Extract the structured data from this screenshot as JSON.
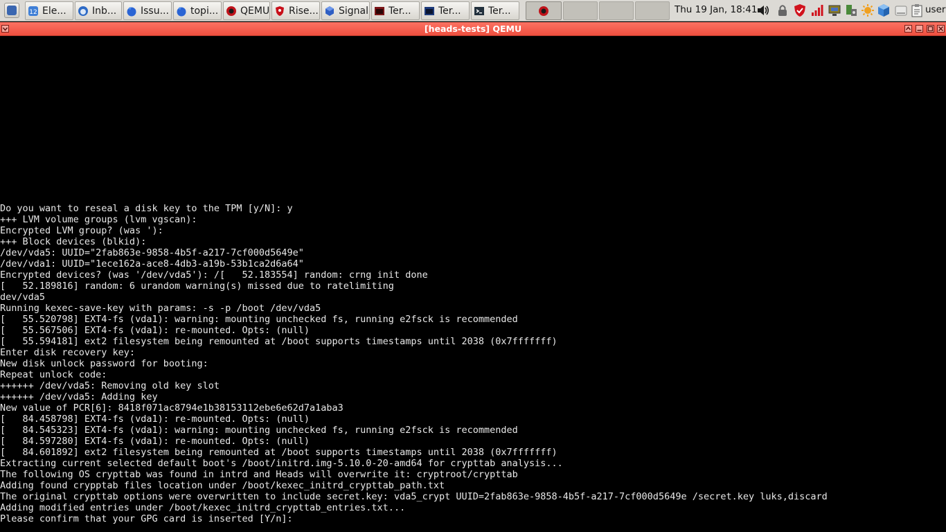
{
  "taskbar": {
    "tasks": [
      {
        "label": "Ele...",
        "icon": "element-icon"
      },
      {
        "label": "Inb...",
        "icon": "thunderbird-icon"
      },
      {
        "label": "Issu...",
        "icon": "firefox-icon"
      },
      {
        "label": "topi...",
        "icon": "firefox-icon"
      },
      {
        "label": "QEMU",
        "icon": "qemu-icon"
      },
      {
        "label": "Rise...",
        "icon": "riseup-icon"
      },
      {
        "label": "Signal",
        "icon": "signal-icon"
      },
      {
        "label": "Ter...",
        "icon": "terminal-icon"
      },
      {
        "label": "Ter...",
        "icon": "terminal-icon"
      },
      {
        "label": "Ter...",
        "icon": "terminal-icon"
      }
    ],
    "clock": "Thu 19 Jan, 18:41",
    "user": "user",
    "tray_icons": [
      "volume-icon",
      "lock-icon",
      "shield-icon",
      "signal-bars-icon",
      "monitor-icon",
      "network-icon",
      "updates-icon",
      "cube-icon",
      "disk-icon",
      "clipboard-icon"
    ]
  },
  "window": {
    "title": "[heads-tests] QEMU"
  },
  "terminal": {
    "lines": [
      "Do you want to reseal a disk key to the TPM [y/N]: y",
      "+++ LVM volume groups (lvm vgscan):",
      "Encrypted LVM group? (was '):",
      "+++ Block devices (blkid):",
      "/dev/vda5: UUID=\"2fab863e-9858-4b5f-a217-7cf000d5649e\"",
      "/dev/vda1: UUID=\"1ece162a-ace8-4db3-a19b-53b1ca2d6a64\"",
      "Encrypted devices? (was '/dev/vda5'): /[   52.183554] random: crng init done",
      "[   52.189816] random: 6 urandom warning(s) missed due to ratelimiting",
      "dev/vda5",
      "Running kexec-save-key with params: -s -p /boot /dev/vda5",
      "[   55.520798] EXT4-fs (vda1): warning: mounting unchecked fs, running e2fsck is recommended",
      "[   55.567506] EXT4-fs (vda1): re-mounted. Opts: (null)",
      "[   55.594181] ext2 filesystem being remounted at /boot supports timestamps until 2038 (0x7fffffff)",
      "Enter disk recovery key:",
      "New disk unlock password for booting:",
      "Repeat unlock code:",
      "++++++ /dev/vda5: Removing old key slot",
      "++++++ /dev/vda5: Adding key",
      "New value of PCR[6]: 8418f071ac8794e1b38153112ebe6e62d7a1aba3",
      "[   84.458798] EXT4-fs (vda1): re-mounted. Opts: (null)",
      "[   84.545323] EXT4-fs (vda1): warning: mounting unchecked fs, running e2fsck is recommended",
      "[   84.597280] EXT4-fs (vda1): re-mounted. Opts: (null)",
      "[   84.601892] ext2 filesystem being remounted at /boot supports timestamps until 2038 (0x7fffffff)",
      "Extracting current selected default boot's /boot/initrd.img-5.10.0-20-amd64 for crypttab analysis...",
      "The following OS crypttab was found in intrd and Heads will overwrite it: cryptroot/crypttab",
      "Adding found crypptab files location under /boot/kexec_initrd_crypttab_path.txt",
      "The original crypttab options were overwritten to include secret.key: vda5_crypt UUID=2fab863e-9858-4b5f-a217-7cf000d5649e /secret.key luks,discard",
      "Adding modified entries under /boot/kexec_initrd_crypttab_entries.txt...",
      "Please confirm that your GPG card is inserted [Y/n]:"
    ]
  }
}
